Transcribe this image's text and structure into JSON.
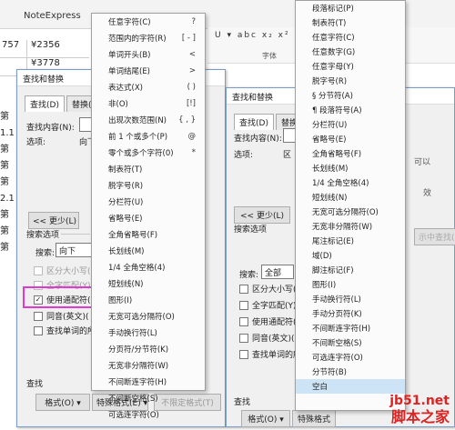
{
  "background": {
    "app_name": "NoteExpress",
    "font_group": "字体",
    "table_rows": [
      {
        "c1": "757",
        "c2": "¥2356"
      },
      {
        "c1": "",
        "c2": "¥3778"
      }
    ],
    "margin_chars": [
      "第",
      "1.1",
      "第",
      "第",
      "第",
      "2.1",
      "第",
      "第",
      "第"
    ]
  },
  "dialog1": {
    "title": "查找和替换",
    "tabs": [
      "查找(D)",
      "替换(P)"
    ],
    "find_label": "查找内容(N):",
    "options_label": "选项:",
    "options_value": "向下",
    "less_button": "<< 更少(L)",
    "search_options_label": "搜索选项",
    "search_label": "搜索:",
    "search_value": "向下",
    "checkboxes": [
      {
        "label": "区分大小写(",
        "checked": false,
        "disabled": true
      },
      {
        "label": "全字匹配(Y)",
        "checked": false,
        "disabled": true
      },
      {
        "label": "使用通配符(U)",
        "checked": true,
        "disabled": false
      },
      {
        "label": "同音(英文)(",
        "checked": false,
        "disabled": false
      },
      {
        "label": "查找单词的所",
        "checked": false,
        "disabled": false
      }
    ],
    "find_section": "查找",
    "format_button": "格式(O) ▾",
    "special_button": "特殊格式(E) ▾",
    "nolimit_button": "不限定格式(T)"
  },
  "menu1": {
    "items": [
      {
        "label": "任意字符(C)",
        "shortcut": "?"
      },
      {
        "label": "范围内的字符(R)",
        "shortcut": "[ - ]"
      },
      {
        "label": "单词开头(B)",
        "shortcut": "<"
      },
      {
        "label": "单词结尾(E)",
        "shortcut": ">"
      },
      {
        "label": "表达式(X)",
        "shortcut": "( )"
      },
      {
        "label": "非(O)",
        "shortcut": "[!]"
      },
      {
        "label": "出现次数范围(N)",
        "shortcut": "{ , }"
      },
      {
        "label": "前 1 个或多个(P)",
        "shortcut": "@"
      },
      {
        "label": "零个或多个字符(0)",
        "shortcut": "*"
      },
      {
        "label": "制表符(T)",
        "shortcut": ""
      },
      {
        "label": "脱字号(R)",
        "shortcut": ""
      },
      {
        "label": "分栏符(U)",
        "shortcut": ""
      },
      {
        "label": "省略号(E)",
        "shortcut": ""
      },
      {
        "label": "全角省略号(F)",
        "shortcut": ""
      },
      {
        "label": "长划线(M)",
        "shortcut": ""
      },
      {
        "label": "1/4 全角空格(4)",
        "shortcut": ""
      },
      {
        "label": "短划线(N)",
        "shortcut": ""
      },
      {
        "label": "图形(I)",
        "shortcut": ""
      },
      {
        "label": "无宽可选分隔符(O)",
        "shortcut": ""
      },
      {
        "label": "手动换行符(L)",
        "shortcut": ""
      },
      {
        "label": "分页符/分节符(K)",
        "shortcut": ""
      },
      {
        "label": "无宽非分隔符(W)",
        "shortcut": ""
      },
      {
        "label": "不间断连字符(H)",
        "shortcut": ""
      },
      {
        "label": "不间断空格(S)",
        "shortcut": ""
      },
      {
        "label": "可选连字符(O)",
        "shortcut": ""
      }
    ]
  },
  "dialog2": {
    "title": "查找和替换",
    "tabs": [
      "查找(D)",
      "替换(P)"
    ],
    "find_label": "查找内容(N):",
    "options_label": "选项:",
    "options_value": "区",
    "less_button": "<< 更少(L)",
    "search_options_label": "搜索选项",
    "search_label": "搜索:",
    "search_value": "全部",
    "checkboxes": [
      {
        "label": "区分大小写(H)",
        "checked": false,
        "disabled": false
      },
      {
        "label": "全字匹配(Y)",
        "checked": false,
        "disabled": false
      },
      {
        "label": "使用通配符(U)",
        "checked": false,
        "disabled": false
      },
      {
        "label": "同音(英文)(K)",
        "checked": false,
        "disabled": false
      },
      {
        "label": "查找单词的所有",
        "checked": false,
        "disabled": false
      }
    ],
    "find_section": "查找",
    "format_button": "格式(O) ▾",
    "special_button": "特殊格式",
    "bg_text_1": "可以",
    "bg_text_2": "效",
    "bg_text_3": "示中查找(I)"
  },
  "menu2": {
    "items": [
      {
        "label": "段落标记(P)"
      },
      {
        "label": "制表符(T)"
      },
      {
        "label": "任意字符(C)"
      },
      {
        "label": "任意数字(G)"
      },
      {
        "label": "任意字母(Y)"
      },
      {
        "label": "脱字号(R)"
      },
      {
        "label": "§ 分节符(A)"
      },
      {
        "label": "¶ 段落符号(A)"
      },
      {
        "label": "分栏符(U)"
      },
      {
        "label": "省略号(E)"
      },
      {
        "label": "全角省略号(F)"
      },
      {
        "label": "长划线(M)"
      },
      {
        "label": "1/4 全角空格(4)"
      },
      {
        "label": "短划线(N)"
      },
      {
        "label": "无宽可选分隔符(O)"
      },
      {
        "label": "无宽非分隔符(W)"
      },
      {
        "label": "尾注标记(E)"
      },
      {
        "label": "域(D)"
      },
      {
        "label": "脚注标记(F)"
      },
      {
        "label": "图形(I)"
      },
      {
        "label": "手动换行符(L)"
      },
      {
        "label": "手动分页符(K)"
      },
      {
        "label": "不间断连字符(H)"
      },
      {
        "label": "不间断空格(S)"
      },
      {
        "label": "可选连字符(O)"
      },
      {
        "label": "分节符(B)"
      },
      {
        "label": "空白"
      }
    ]
  },
  "watermark": {
    "line1": "jb51.net",
    "line2": "脚本之家"
  }
}
